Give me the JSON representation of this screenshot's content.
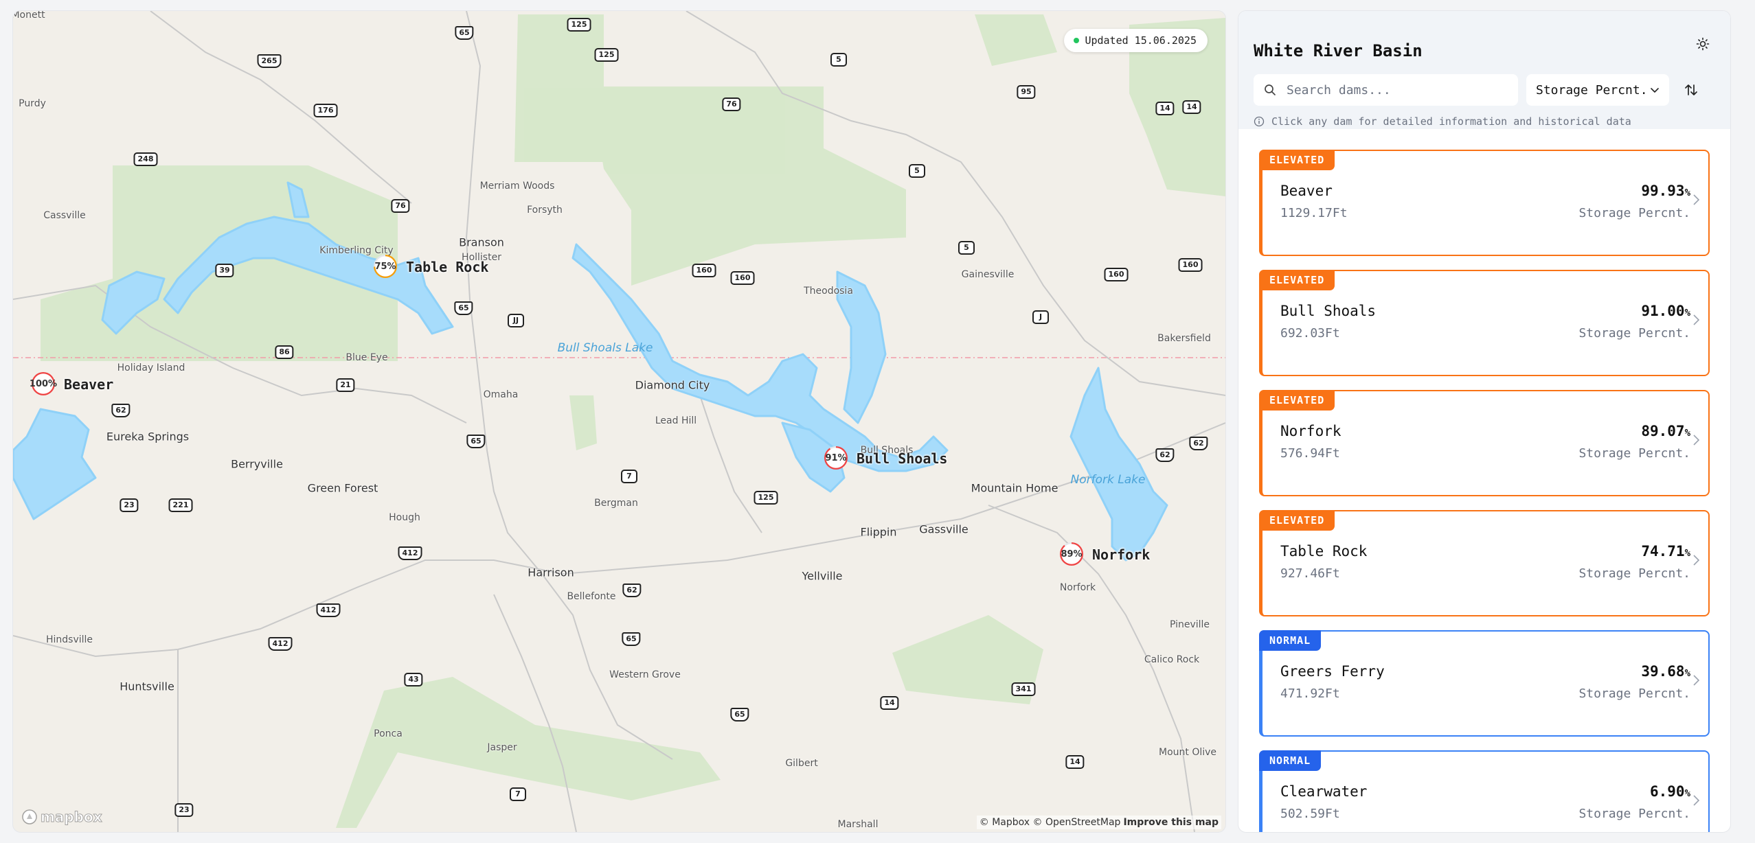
{
  "map": {
    "updated": "Updated 15.06.2025",
    "lakes": [
      "Bull Shoals Lake",
      "Norfork Lake"
    ],
    "towns": [
      "Monett",
      "Purdy",
      "Cassville",
      "Kimberling City",
      "Branson",
      "Hollister",
      "Merriam Woods",
      "Forsyth",
      "Theodosia",
      "Gainesville",
      "Bakersfield",
      "Holiday Island",
      "Blue Eye",
      "Eureka Springs",
      "Omaha",
      "Diamond City",
      "Lead Hill",
      "Berryville",
      "Green Forest",
      "Hough",
      "Bergman",
      "Flippin",
      "Gassville",
      "Mountain Home",
      "Harrison",
      "Bellefonte",
      "Yellville",
      "Norfork",
      "Pineville",
      "Calico Rock",
      "Hindsville",
      "Huntsville",
      "Western Grove",
      "Ponca",
      "Jasper",
      "Gilbert",
      "Marshall",
      "Mount Olive",
      "Bull Shoals"
    ],
    "shields": [
      "65",
      "125",
      "265",
      "176",
      "248",
      "76",
      "39",
      "86",
      "21",
      "62",
      "23",
      "221",
      "412",
      "65",
      "7",
      "125",
      "62",
      "65",
      "43",
      "7",
      "23",
      "65",
      "14",
      "341",
      "5",
      "76",
      "95",
      "14",
      "14",
      "5",
      "5",
      "160",
      "160",
      "160",
      "160",
      "J",
      "JJ",
      "62",
      "62",
      "14",
      "125",
      "412",
      "412",
      "65"
    ],
    "dams": [
      {
        "name": "Table Rock",
        "pct": "75%",
        "color": "#f59e0b",
        "level": 0.7471
      },
      {
        "name": "Beaver",
        "pct": "100%",
        "color": "#ef4444",
        "level": 0.9993
      },
      {
        "name": "Bull Shoals",
        "pct": "91%",
        "color": "#ef4444",
        "level": 0.91
      },
      {
        "name": "Norfork",
        "pct": "89%",
        "color": "#ef4444",
        "level": 0.8907
      }
    ],
    "logo": "mapbox",
    "attribution": "© Mapbox © OpenStreetMap",
    "improve": "Improve this map"
  },
  "panel": {
    "title": "White River Basin",
    "search_placeholder": "Search dams...",
    "sort_label": "Storage Percnt.",
    "hint": "Click any dam for detailed information and historical data",
    "cards": [
      {
        "status": "ELEVATED",
        "name": "Beaver",
        "elevation": "1129.17Ft",
        "value": "99.93",
        "unit": "%",
        "metric": "Storage Percnt."
      },
      {
        "status": "ELEVATED",
        "name": "Bull Shoals",
        "elevation": "692.03Ft",
        "value": "91.00",
        "unit": "%",
        "metric": "Storage Percnt."
      },
      {
        "status": "ELEVATED",
        "name": "Norfork",
        "elevation": "576.94Ft",
        "value": "89.07",
        "unit": "%",
        "metric": "Storage Percnt."
      },
      {
        "status": "ELEVATED",
        "name": "Table Rock",
        "elevation": "927.46Ft",
        "value": "74.71",
        "unit": "%",
        "metric": "Storage Percnt."
      },
      {
        "status": "NORMAL",
        "name": "Greers Ferry",
        "elevation": "471.92Ft",
        "value": "39.68",
        "unit": "%",
        "metric": "Storage Percnt."
      },
      {
        "status": "NORMAL",
        "name": "Clearwater",
        "elevation": "502.59Ft",
        "value": "6.90",
        "unit": "%",
        "metric": "Storage Percnt."
      }
    ]
  }
}
